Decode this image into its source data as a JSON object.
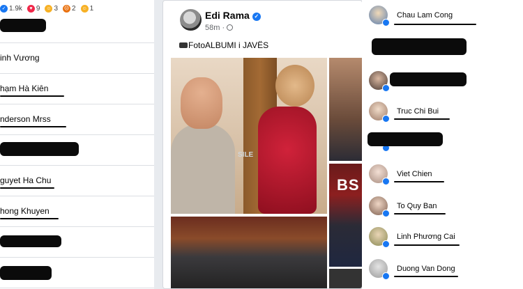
{
  "reactions": {
    "like_count": "1.9k",
    "love_count": "9",
    "care_count": "3",
    "angry_count": "2",
    "haha_count": "1"
  },
  "left_list": {
    "names": [
      "inh Vương",
      "hạm Hà Kiên",
      "nderson Mrss",
      "guyet Ha Chu",
      "hong Khuyen"
    ]
  },
  "post": {
    "author": "Edi Rama",
    "time": "58m",
    "caption": "FotoALBUMI i JAVËS",
    "sign_text": "SILE",
    "banner_text": "BS"
  },
  "right_list": {
    "names": [
      "Chau Lam Cong",
      "Truc Chi Bui",
      "Viet Chien",
      "To Quy Ban",
      "Linh Phương Cai",
      "Duong Van Dong"
    ]
  },
  "colors": {
    "facebook_blue": "#1877f2",
    "love_red": "#f02849",
    "care_yellow": "#f7b125",
    "angry_orange": "#e9710f",
    "redaction_black": "#0b0b0b"
  },
  "icons": {
    "verified": "verified-badge-icon",
    "globe": "globe-icon",
    "camera": "camera-icon",
    "like": "like-reaction-icon"
  }
}
